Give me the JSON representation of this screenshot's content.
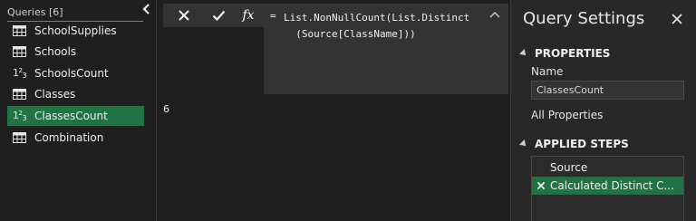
{
  "queries": {
    "header": "Queries [6]",
    "items": [
      {
        "label": "SchoolSupplies",
        "icon": "table-icon"
      },
      {
        "label": "Schools",
        "icon": "table-icon"
      },
      {
        "label": "SchoolsCount",
        "icon": "number-icon"
      },
      {
        "label": "Classes",
        "icon": "table-icon"
      },
      {
        "label": "ClassesCount",
        "icon": "number-icon",
        "selected": true
      },
      {
        "label": "Combination",
        "icon": "table-icon"
      }
    ]
  },
  "formula": {
    "fx": "fx",
    "equals": "=",
    "text": "List.NonNullCount(List.Distinct\n  (Source[ClassName]))"
  },
  "result": {
    "value": "6"
  },
  "settings": {
    "title": "Query Settings",
    "properties_heading": "PROPERTIES",
    "name_label": "Name",
    "name_value": "ClassesCount",
    "all_properties": "All Properties",
    "applied_steps_heading": "APPLIED STEPS",
    "steps": [
      {
        "label": "Source"
      },
      {
        "label": "Calculated Distinct C...",
        "selected": true
      }
    ]
  },
  "colors": {
    "accent": "#217346",
    "background": "#1f1f1f",
    "panel": "#282828"
  }
}
